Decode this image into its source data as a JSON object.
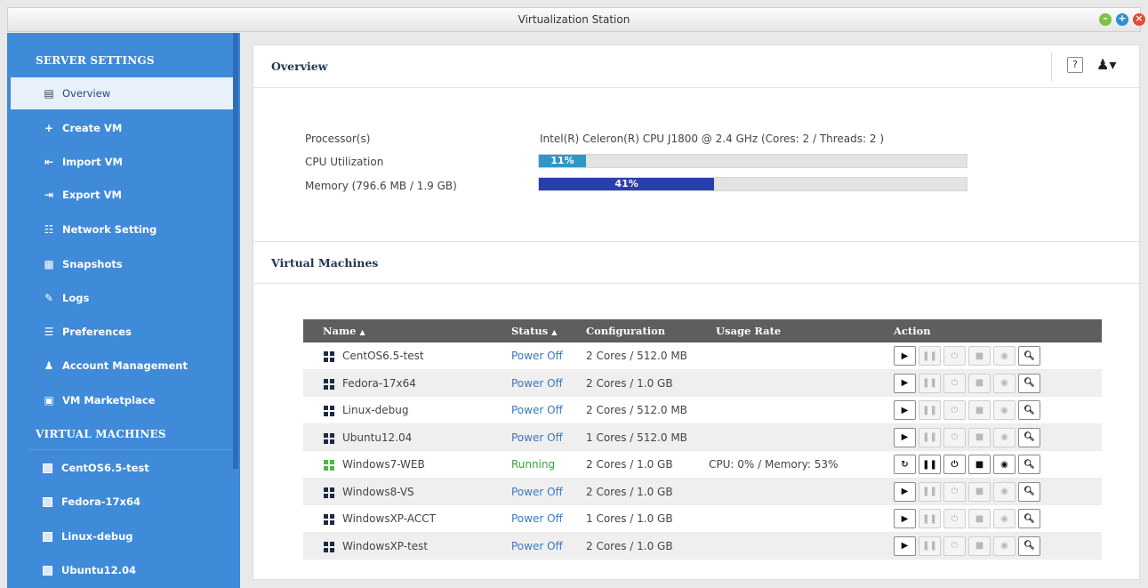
{
  "window": {
    "title": "Virtualization Station"
  },
  "sidebar": {
    "server_settings_heading": "SERVER SETTINGS",
    "items": [
      {
        "label": "Overview",
        "icon": "overview-icon"
      },
      {
        "label": "Create VM",
        "icon": "plus-icon"
      },
      {
        "label": "Import VM",
        "icon": "import-icon"
      },
      {
        "label": "Export VM",
        "icon": "export-icon"
      },
      {
        "label": "Network Setting",
        "icon": "network-icon"
      },
      {
        "label": "Snapshots",
        "icon": "snapshots-icon"
      },
      {
        "label": "Logs",
        "icon": "logs-icon"
      },
      {
        "label": "Preferences",
        "icon": "preferences-icon"
      },
      {
        "label": "Account Management",
        "icon": "account-icon"
      },
      {
        "label": "VM Marketplace",
        "icon": "marketplace-icon"
      }
    ],
    "virtual_machines_heading": "VIRTUAL MACHINES",
    "vms": [
      "CentOS6.5-test",
      "Fedora-17x64",
      "Linux-debug",
      "Ubuntu12.04"
    ]
  },
  "overview": {
    "title": "Overview",
    "help_label": "?",
    "processor_label": "Processor(s)",
    "processor_value": "Intel(R) Celeron(R) CPU J1800 @ 2.4 GHz (Cores: 2 / Threads: 2 )",
    "cpu_label": "CPU Utilization",
    "cpu_percent_text": "11%",
    "cpu_percent": 11,
    "memory_label": "Memory (796.6 MB / 1.9 GB)",
    "memory_percent_text": "41%",
    "memory_percent": 41
  },
  "vms_section": {
    "title": "Virtual Machines",
    "columns": {
      "name": "Name",
      "name_sort": "▲",
      "status": "Status",
      "status_sort": "▲",
      "configuration": "Configuration",
      "usage_rate": "Usage Rate",
      "action": "Action"
    },
    "rows": [
      {
        "name": "CentOS6.5-test",
        "status": "Power Off",
        "config": "2 Cores / 512.0 MB",
        "usage": "",
        "running": false
      },
      {
        "name": "Fedora-17x64",
        "status": "Power Off",
        "config": "2 Cores / 1.0 GB",
        "usage": "",
        "running": false
      },
      {
        "name": "Linux-debug",
        "status": "Power Off",
        "config": "2 Cores / 512.0 MB",
        "usage": "",
        "running": false
      },
      {
        "name": "Ubuntu12.04",
        "status": "Power Off",
        "config": "1 Cores / 512.0 MB",
        "usage": "",
        "running": false
      },
      {
        "name": "Windows7-WEB",
        "status": "Running",
        "config": "2 Cores / 1.0 GB",
        "usage": "CPU: 0% / Memory: 53%",
        "running": true
      },
      {
        "name": "Windows8-VS",
        "status": "Power Off",
        "config": "2 Cores / 1.0 GB",
        "usage": "",
        "running": false
      },
      {
        "name": "WindowsXP-ACCT",
        "status": "Power Off",
        "config": "1 Cores / 1.0 GB",
        "usage": "",
        "running": false
      },
      {
        "name": "WindowsXP-test",
        "status": "Power Off",
        "config": "2 Cores / 1.0 GB",
        "usage": "",
        "running": false
      }
    ]
  },
  "colors": {
    "sidebar": "#3f8ad9",
    "cpu_bar": "#2d98c8",
    "memory_bar": "#2a3fae",
    "status_off": "#3a78c2",
    "status_running": "#3aa13a"
  }
}
